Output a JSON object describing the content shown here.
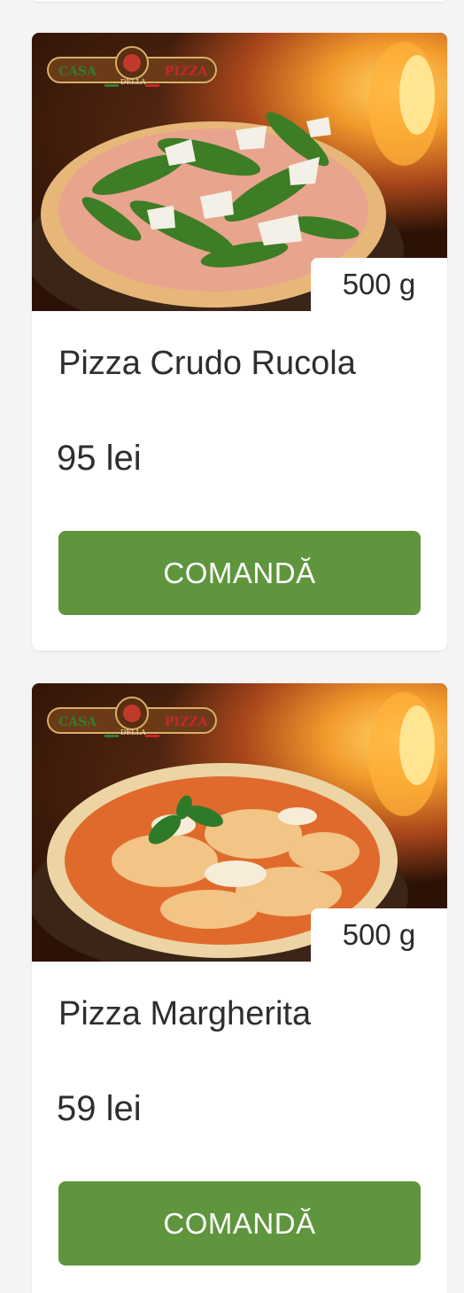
{
  "products": [
    {
      "weight": "500 g",
      "name": "Pizza Crudo Rucola",
      "price": "95 lei",
      "button": "COMANDĂ",
      "logo": {
        "left": "CASA",
        "middle": "DELLA",
        "right": "PIZZA"
      }
    },
    {
      "weight": "500 g",
      "name": "Pizza Margherita",
      "price": "59 lei",
      "button": "COMANDĂ",
      "logo": {
        "left": "CASA",
        "middle": "DELLA",
        "right": "PIZZA"
      }
    }
  ],
  "colors": {
    "button": "#5e953d",
    "background": "#f4f4f3",
    "card": "#ffffff",
    "text": "#2e2e2e"
  }
}
